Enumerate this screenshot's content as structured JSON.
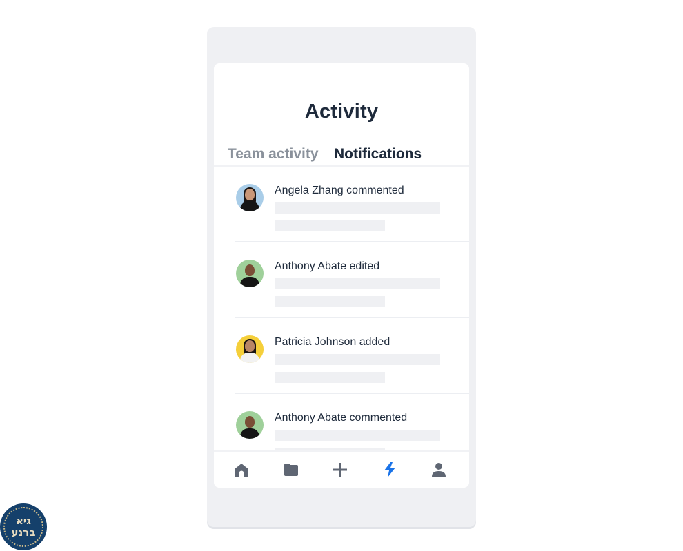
{
  "screen": {
    "title": "Activity",
    "tabs": [
      {
        "label": "Team activity",
        "active": false
      },
      {
        "label": "Notifications",
        "active": true
      }
    ]
  },
  "notifications": [
    {
      "text": "Angela Zhang commented",
      "avatar_color": "#a9cde8",
      "avatar_icon": "person-avatar-woman"
    },
    {
      "text": "Anthony Abate edited",
      "avatar_color": "#9fd09a",
      "avatar_icon": "person-avatar-man"
    },
    {
      "text": "Patricia Johnson added",
      "avatar_color": "#f5cf3a",
      "avatar_icon": "person-avatar-woman"
    },
    {
      "text": "Anthony Abate commented",
      "avatar_color": "#9fd09a",
      "avatar_icon": "person-avatar-man"
    }
  ],
  "bottom_nav": [
    {
      "icon": "home-icon",
      "active": false
    },
    {
      "icon": "folder-icon",
      "active": false
    },
    {
      "icon": "plus-icon",
      "active": false
    },
    {
      "icon": "lightning-icon",
      "active": true
    },
    {
      "icon": "person-icon",
      "active": false
    }
  ],
  "colors": {
    "accent": "#1a73e8",
    "nav_inactive": "#5f6673",
    "text_primary": "#1e2a3b",
    "text_muted": "#8a919b"
  },
  "watermark": {
    "line1": "גיא",
    "line2": "ברנע"
  }
}
